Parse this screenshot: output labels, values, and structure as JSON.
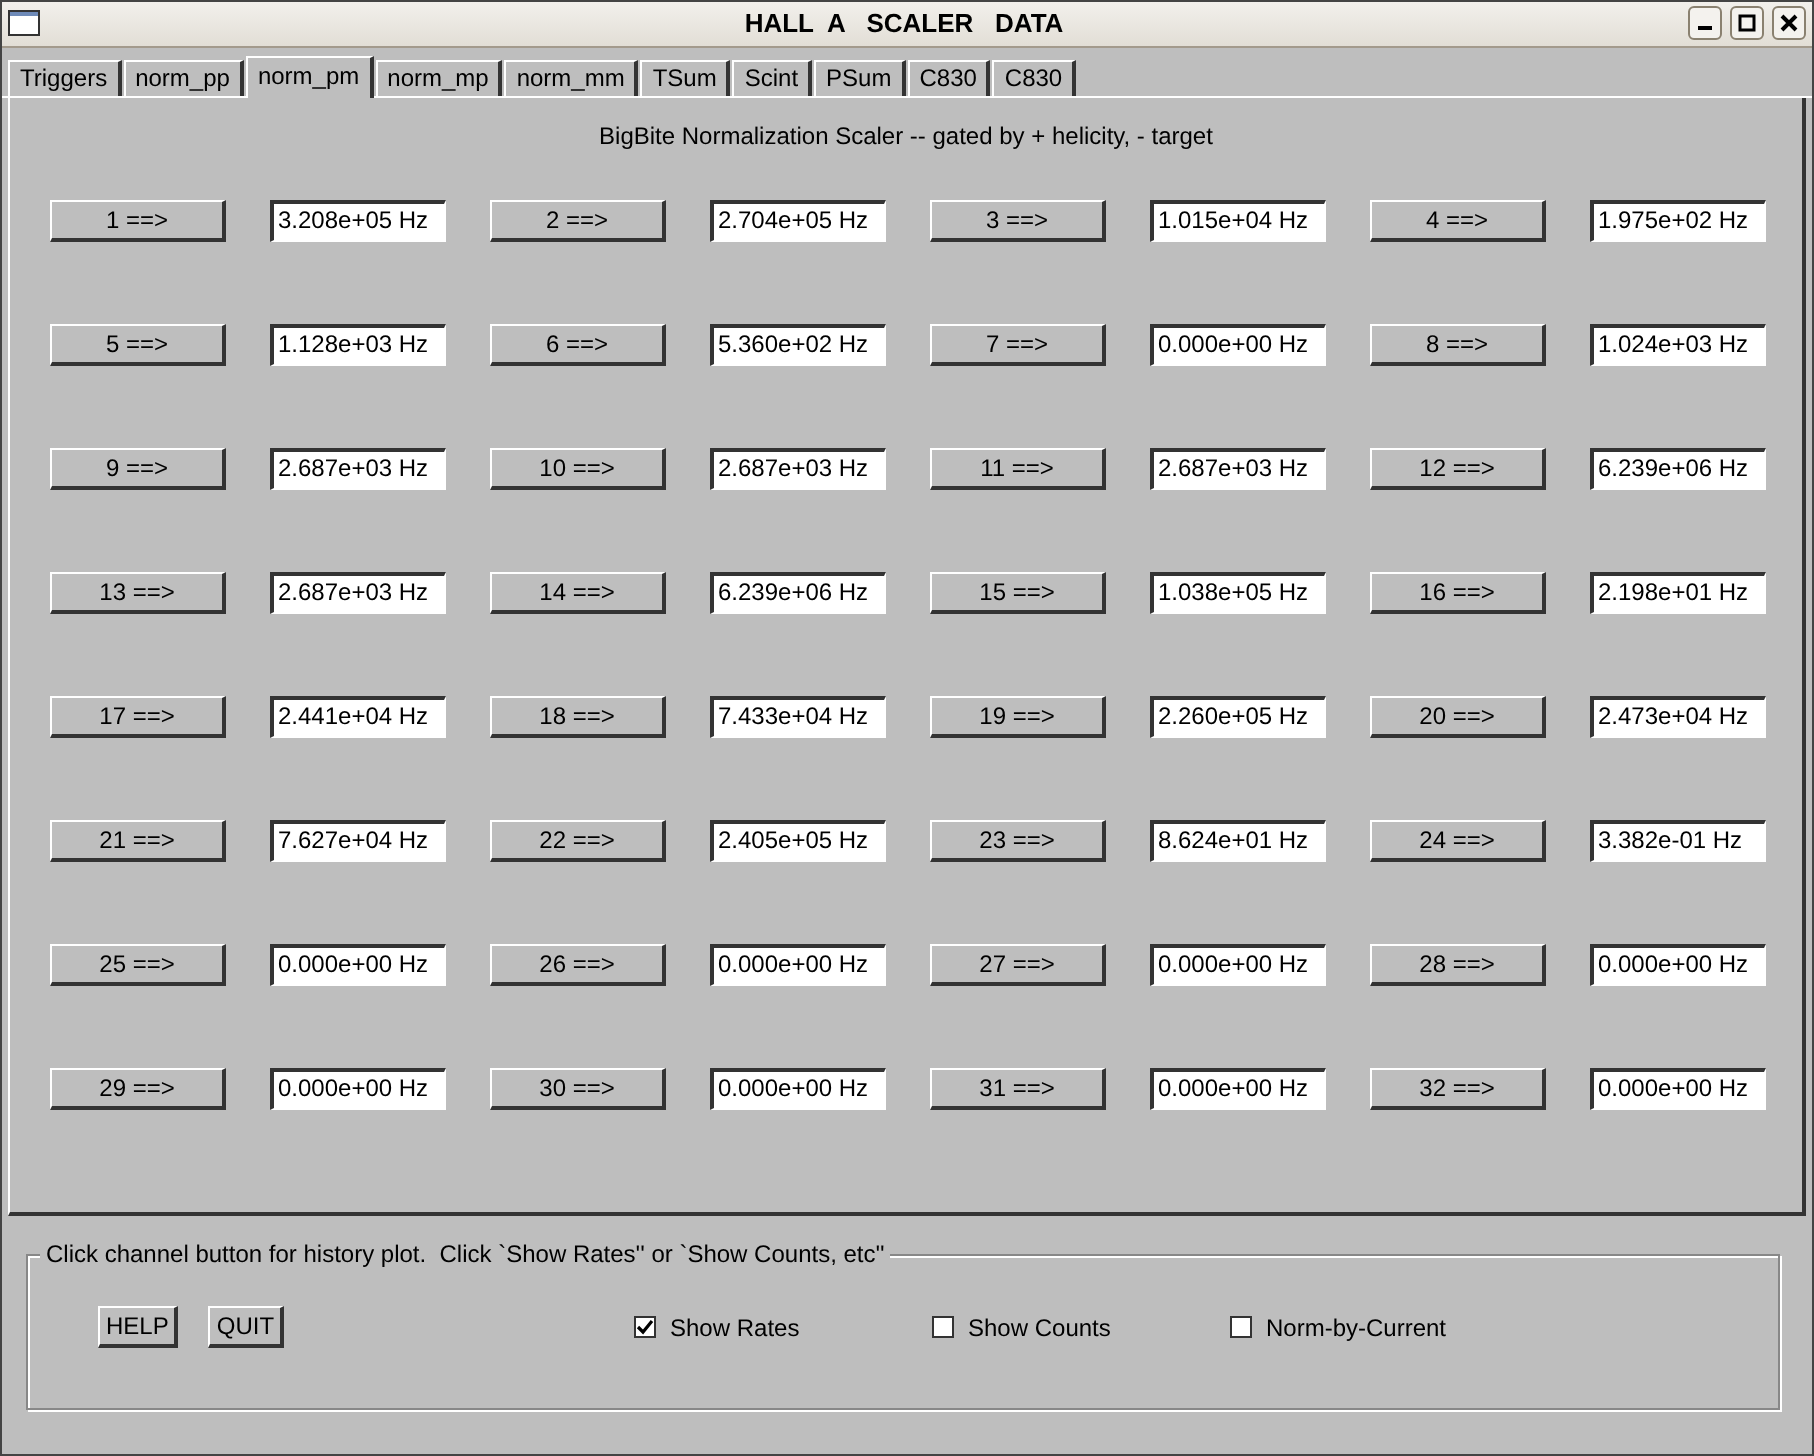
{
  "window": {
    "title": "HALL  A   SCALER   DATA"
  },
  "tabs": [
    {
      "label": "Triggers",
      "selected": false
    },
    {
      "label": "norm_pp",
      "selected": false
    },
    {
      "label": "norm_pm",
      "selected": true
    },
    {
      "label": "norm_mp",
      "selected": false
    },
    {
      "label": "norm_mm",
      "selected": false
    },
    {
      "label": "TSum",
      "selected": false
    },
    {
      "label": "Scint",
      "selected": false
    },
    {
      "label": "PSum",
      "selected": false
    },
    {
      "label": "C830",
      "selected": false
    },
    {
      "label": "C830",
      "selected": false
    }
  ],
  "panel_title": "BigBite Normalization Scaler -- gated by + helicity, - target",
  "channels": [
    {
      "button": "1 ==>",
      "value": "3.208e+05 Hz"
    },
    {
      "button": "2 ==>",
      "value": "2.704e+05 Hz"
    },
    {
      "button": "3 ==>",
      "value": "1.015e+04 Hz"
    },
    {
      "button": "4 ==>",
      "value": "1.975e+02 Hz"
    },
    {
      "button": "5 ==>",
      "value": "1.128e+03 Hz"
    },
    {
      "button": "6 ==>",
      "value": "5.360e+02 Hz"
    },
    {
      "button": "7 ==>",
      "value": "0.000e+00 Hz"
    },
    {
      "button": "8 ==>",
      "value": "1.024e+03 Hz"
    },
    {
      "button": "9 ==>",
      "value": "2.687e+03 Hz"
    },
    {
      "button": "10 ==>",
      "value": "2.687e+03 Hz"
    },
    {
      "button": "11 ==>",
      "value": "2.687e+03 Hz"
    },
    {
      "button": "12 ==>",
      "value": "6.239e+06 Hz"
    },
    {
      "button": "13 ==>",
      "value": "2.687e+03 Hz"
    },
    {
      "button": "14 ==>",
      "value": "6.239e+06 Hz"
    },
    {
      "button": "15 ==>",
      "value": "1.038e+05 Hz"
    },
    {
      "button": "16 ==>",
      "value": "2.198e+01 Hz"
    },
    {
      "button": "17 ==>",
      "value": "2.441e+04 Hz"
    },
    {
      "button": "18 ==>",
      "value": "7.433e+04 Hz"
    },
    {
      "button": "19 ==>",
      "value": "2.260e+05 Hz"
    },
    {
      "button": "20 ==>",
      "value": "2.473e+04 Hz"
    },
    {
      "button": "21 ==>",
      "value": "7.627e+04 Hz"
    },
    {
      "button": "22 ==>",
      "value": "2.405e+05 Hz"
    },
    {
      "button": "23 ==>",
      "value": "8.624e+01 Hz"
    },
    {
      "button": "24 ==>",
      "value": "3.382e-01 Hz"
    },
    {
      "button": "25 ==>",
      "value": "0.000e+00 Hz"
    },
    {
      "button": "26 ==>",
      "value": "0.000e+00 Hz"
    },
    {
      "button": "27 ==>",
      "value": "0.000e+00 Hz"
    },
    {
      "button": "28 ==>",
      "value": "0.000e+00 Hz"
    },
    {
      "button": "29 ==>",
      "value": "0.000e+00 Hz"
    },
    {
      "button": "30 ==>",
      "value": "0.000e+00 Hz"
    },
    {
      "button": "31 ==>",
      "value": "0.000e+00 Hz"
    },
    {
      "button": "32 ==>",
      "value": "0.000e+00 Hz"
    }
  ],
  "controls": {
    "legend": "Click channel button for history plot.  Click `Show Rates'' or `Show Counts, etc''",
    "buttons": [
      "HELP",
      "QUIT"
    ],
    "checkboxes": [
      {
        "label": "Show Rates",
        "checked": true
      },
      {
        "label": "Show Counts",
        "checked": false
      },
      {
        "label": "Norm-by-Current",
        "checked": false
      }
    ]
  }
}
